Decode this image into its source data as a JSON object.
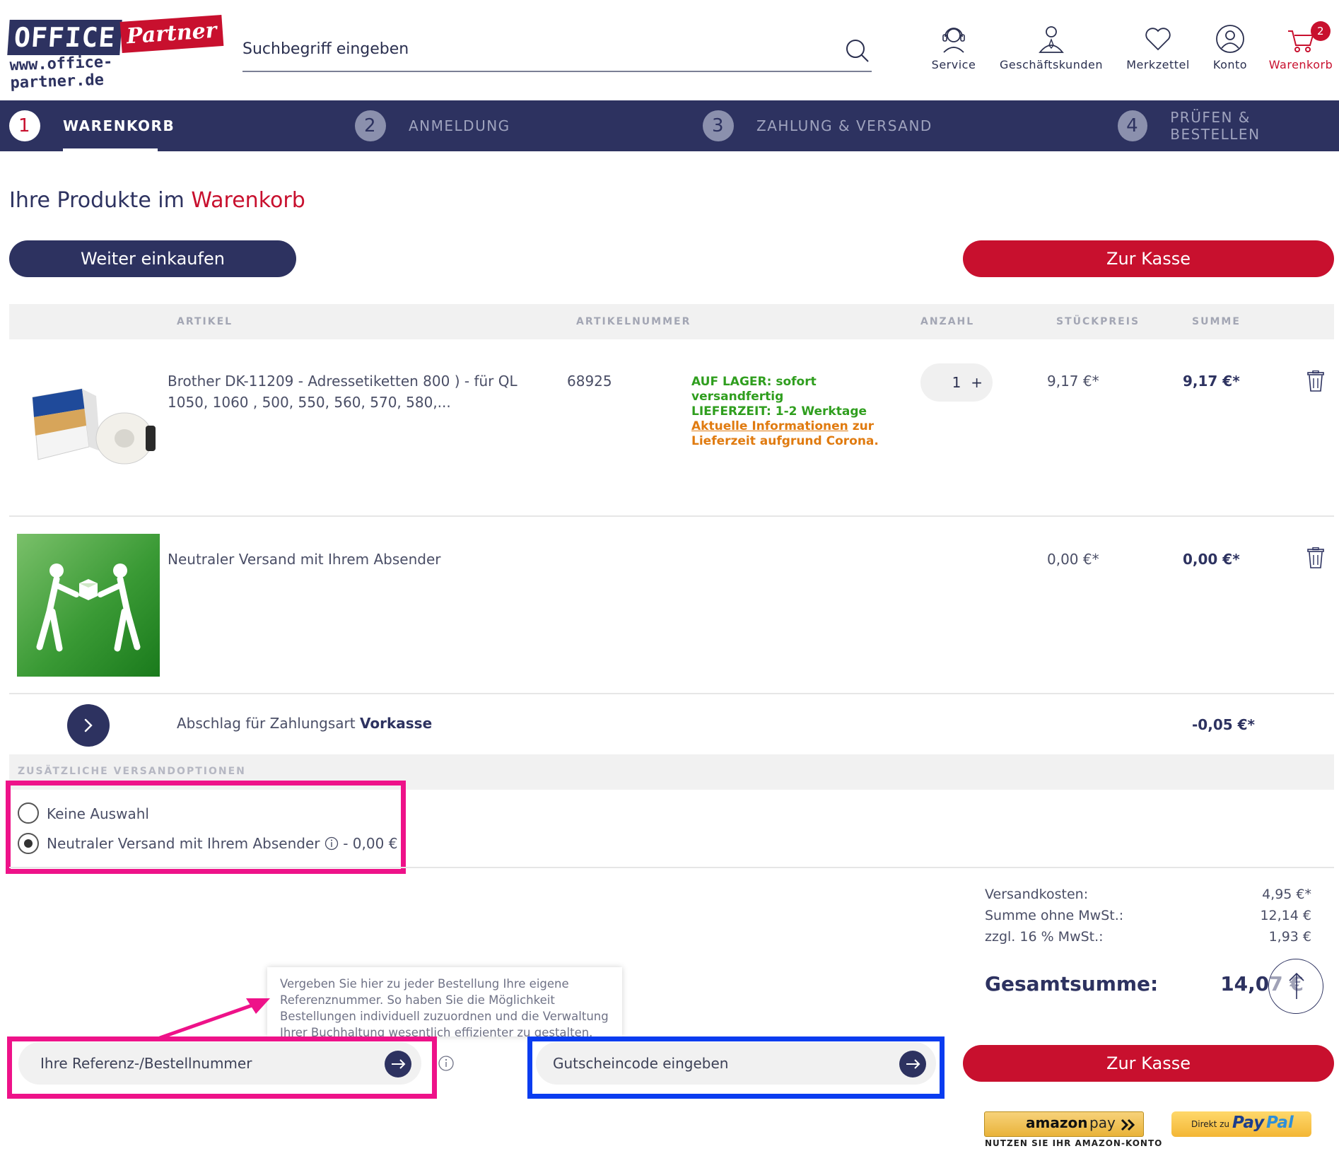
{
  "header": {
    "logo_office": "OFFICE",
    "logo_partner": "Partner",
    "logo_url": "www.office-partner.de",
    "search_placeholder": "Suchbegriff eingeben",
    "nav": [
      {
        "label": "Service",
        "icon": "headset-icon"
      },
      {
        "label": "Geschäftskunden",
        "icon": "business-person-icon"
      },
      {
        "label": "Merkzettel",
        "icon": "heart-icon"
      },
      {
        "label": "Konto",
        "icon": "user-icon"
      },
      {
        "label": "Warenkorb",
        "icon": "cart-icon",
        "badge": "2"
      }
    ]
  },
  "steps": [
    {
      "num": "1",
      "label": "WARENKORB",
      "active": true
    },
    {
      "num": "2",
      "label": "ANMELDUNG"
    },
    {
      "num": "3",
      "label": "ZAHLUNG & VERSAND"
    },
    {
      "num": "4",
      "label": "PRÜFEN & BESTELLEN"
    }
  ],
  "page": {
    "title_prefix": "Ihre Produkte im",
    "title_highlight": "Warenkorb",
    "continue_label": "Weiter einkaufen",
    "checkout_label": "Zur Kasse"
  },
  "table": {
    "headers": [
      "ARTIKEL",
      "ARTIKELNUMMER",
      "ANZAHL",
      "STÜCKPREIS",
      "SUMME"
    ],
    "items": [
      {
        "name_line1": "Brother DK-11209 - Adressetiketten 800 ) - für QL",
        "name_line2": "1050, 1060 , 500, 550, 560, 570, 580,...",
        "sku": "68925",
        "stock_line1": "AUF LAGER: sofort versandfertig",
        "stock_line2": "LIEFERZEIT: 1-2 Werktage",
        "info_link": "Aktuelle Informationen",
        "info_rest1": "zur",
        "info_rest2": "Lieferzeit aufgrund Corona.",
        "qty": "1",
        "unit_price": "9,17 €*",
        "total": "9,17 €*"
      },
      {
        "name": "Neutraler Versand mit Ihrem Absender",
        "unit_price": "0,00 €*",
        "total": "0,00 €*"
      }
    ],
    "discount_label": "Abschlag für Zahlungsart",
    "discount_method": "Vorkasse",
    "discount_value": "-0,05 €*"
  },
  "shipping_options": {
    "heading": "ZUSÄTZLICHE VERSANDOPTIONEN",
    "options": [
      {
        "label": "Keine Auswahl",
        "checked": false
      },
      {
        "label": "Neutraler Versand mit Ihrem Absender",
        "suffix": "- 0,00 €",
        "checked": true
      }
    ]
  },
  "reference": {
    "tooltip": "Vergeben Sie hier zu jeder Bestellung Ihre eigene Referenznummer. So haben Sie die Möglichkeit Bestellungen individuell zuzuordnen und die Verwaltung Ihrer Buchhaltung wesentlich effizienter zu gestalten.",
    "placeholder": "Ihre Referenz-/Bestellnummer"
  },
  "coupon": {
    "placeholder": "Gutscheincode eingeben"
  },
  "summary": {
    "rows": [
      {
        "label": "Versandkosten:",
        "value": "4,95 €*"
      },
      {
        "label": "Summe ohne MwSt.:",
        "value": "12,14 €"
      },
      {
        "label": "zzgl. 16 % MwSt.:",
        "value": "1,93 €"
      }
    ],
    "total_label": "Gesamtsumme:",
    "total_value": "14,07 €"
  },
  "payments": {
    "amazon_brand": "amazon",
    "amazon_pay": "pay",
    "amazon_caption": "NUTZEN SIE IHR AMAZON-KONTO",
    "paypal_prefix": "Direkt zu",
    "paypal_pay": "Pay",
    "paypal_pal": "Pal"
  },
  "colors": {
    "brand_blue": "#2d3260",
    "brand_red": "#c8102e",
    "highlight_pink": "#ee1289",
    "highlight_blue": "#0a3cf0"
  }
}
